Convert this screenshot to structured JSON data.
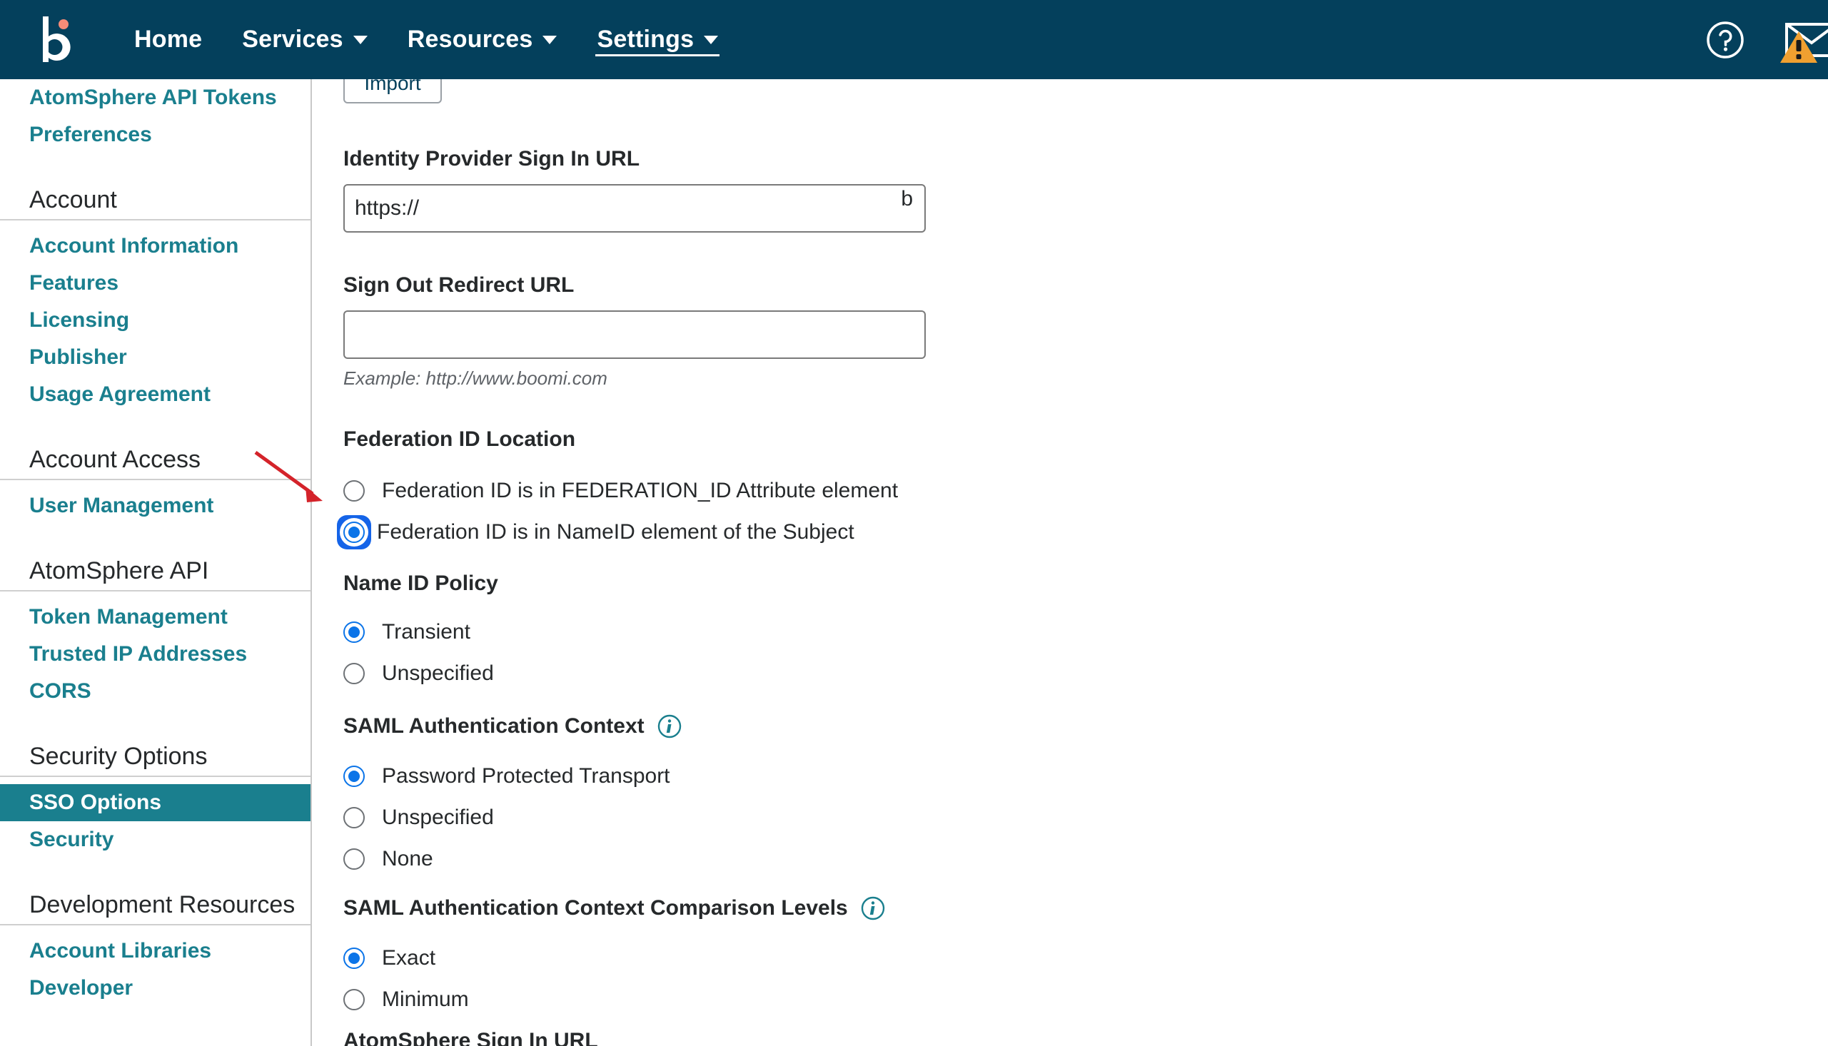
{
  "topnav": {
    "logo_alt": "boomi-logo",
    "items": [
      {
        "label": "Home",
        "has_caret": false,
        "active": false
      },
      {
        "label": "Services",
        "has_caret": true,
        "active": false
      },
      {
        "label": "Resources",
        "has_caret": true,
        "active": false
      },
      {
        "label": "Settings",
        "has_caret": true,
        "active": true
      }
    ],
    "help_icon": "question-circle-icon",
    "mail_icon": "envelope-icon",
    "warning_icon": "warning-triangle-icon"
  },
  "colors": {
    "header_bg": "#04405c",
    "link_teal": "#1a7f8e",
    "selected_bg": "#1a7f8e",
    "radio_blue": "#0b74e8",
    "focus_ring": "#1564e8",
    "warning_orange": "#f0a030",
    "logo_dot": "#f58c78",
    "annotation_red": "#d4232a"
  },
  "sidebar": {
    "top_links": [
      {
        "label": "AtomSphere API Tokens",
        "selected": false
      },
      {
        "label": "Preferences",
        "selected": false
      }
    ],
    "sections": [
      {
        "header": "Account",
        "links": [
          {
            "label": "Account Information",
            "selected": false
          },
          {
            "label": "Features",
            "selected": false
          },
          {
            "label": "Licensing",
            "selected": false
          },
          {
            "label": "Publisher",
            "selected": false
          },
          {
            "label": "Usage Agreement",
            "selected": false
          }
        ]
      },
      {
        "header": "Account Access",
        "links": [
          {
            "label": "User Management",
            "selected": false
          }
        ]
      },
      {
        "header": "AtomSphere API",
        "links": [
          {
            "label": "Token Management",
            "selected": false
          },
          {
            "label": "Trusted IP Addresses",
            "selected": false
          },
          {
            "label": "CORS",
            "selected": false
          }
        ]
      },
      {
        "header": "Security Options",
        "links": [
          {
            "label": "SSO Options",
            "selected": true
          },
          {
            "label": "Security",
            "selected": false
          }
        ]
      },
      {
        "header": "Development Resources",
        "links": [
          {
            "label": "Account Libraries",
            "selected": false
          },
          {
            "label": "Developer",
            "selected": false
          }
        ]
      }
    ]
  },
  "main": {
    "import_button": "Import",
    "idp_signin": {
      "label": "Identity Provider Sign In URL",
      "value": "https://",
      "trailing_char": "b"
    },
    "signout_redirect": {
      "label": "Sign Out Redirect URL",
      "value": "",
      "hint": "Example: http://www.boomi.com"
    },
    "federation_id_location": {
      "label": "Federation ID Location",
      "options": [
        {
          "label": "Federation ID is in FEDERATION_ID Attribute element",
          "checked": false,
          "focused": false
        },
        {
          "label": "Federation ID is in NameID element of the Subject",
          "checked": true,
          "focused": true
        }
      ]
    },
    "name_id_policy": {
      "label": "Name ID Policy",
      "options": [
        {
          "label": "Transient",
          "checked": true,
          "focused": false
        },
        {
          "label": "Unspecified",
          "checked": false,
          "focused": false
        }
      ]
    },
    "saml_auth_context": {
      "label": "SAML Authentication Context",
      "info_icon": "info-icon",
      "options": [
        {
          "label": "Password Protected Transport",
          "checked": true,
          "focused": false
        },
        {
          "label": "Unspecified",
          "checked": false,
          "focused": false
        },
        {
          "label": "None",
          "checked": false,
          "focused": false
        }
      ]
    },
    "saml_comparison_levels": {
      "label": "SAML Authentication Context Comparison Levels",
      "info_icon": "info-icon",
      "options": [
        {
          "label": "Exact",
          "checked": true,
          "focused": false
        },
        {
          "label": "Minimum",
          "checked": false,
          "focused": false
        }
      ]
    },
    "bottom_partial_label": "AtomSphere Sign In URL"
  }
}
